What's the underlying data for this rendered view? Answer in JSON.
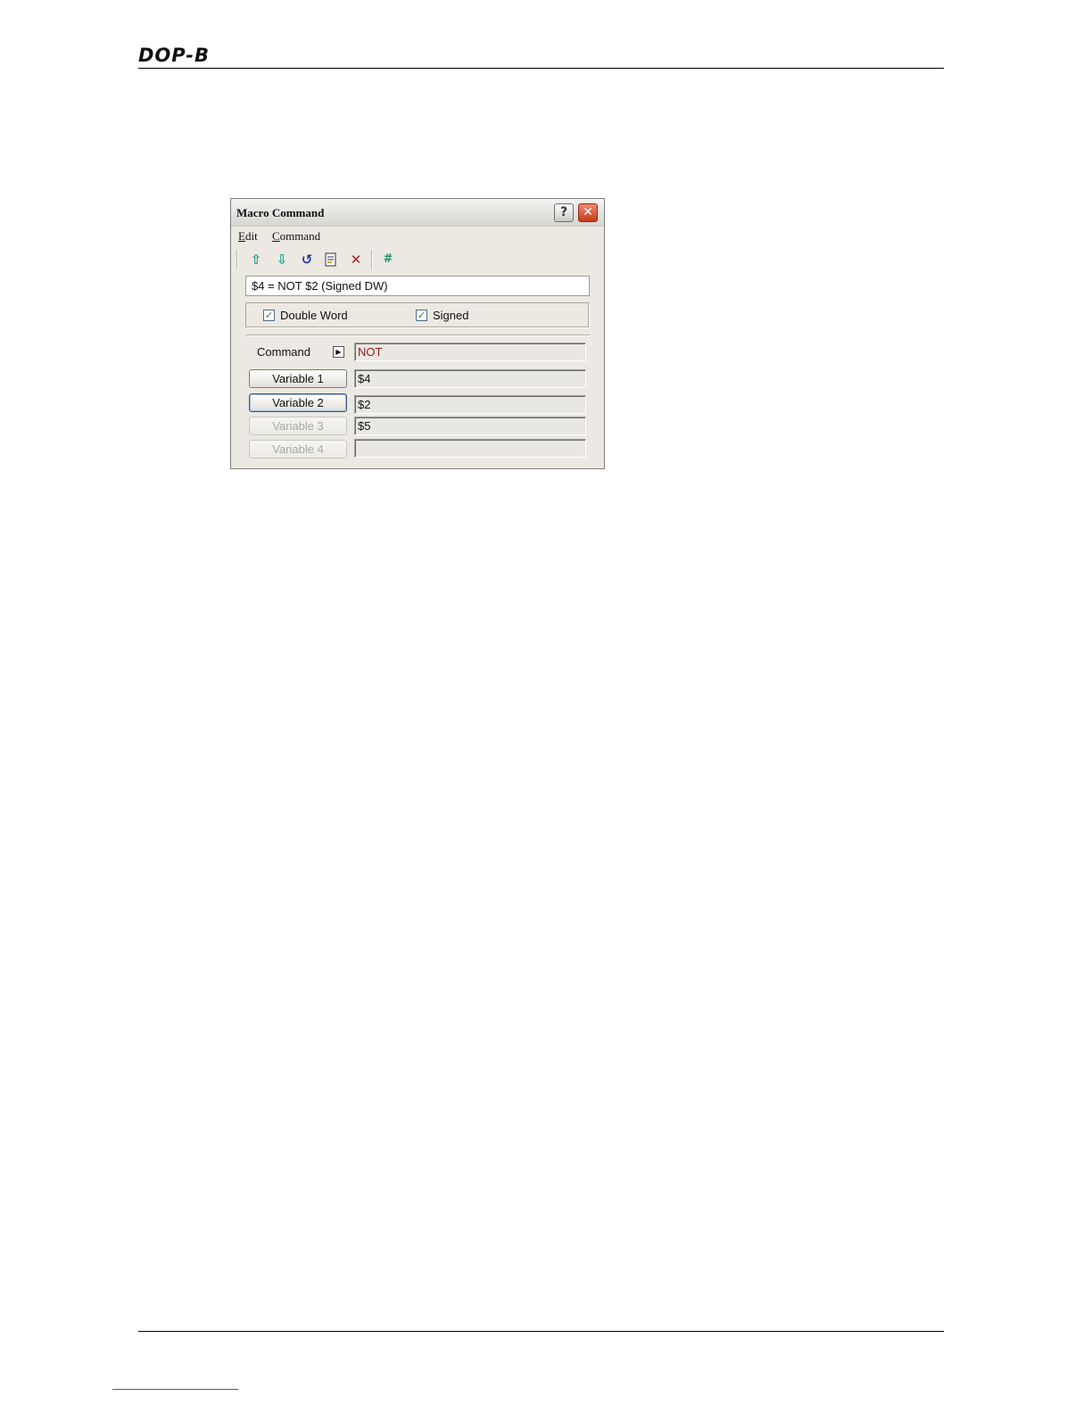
{
  "page": {
    "header_logo": "DOP-B"
  },
  "dialog": {
    "title": "Macro Command",
    "help_label": "?",
    "close_label": "✕",
    "menu": [
      "Edit",
      "Command"
    ],
    "toolbar_icons": [
      "arrow-up-icon",
      "arrow-down-icon",
      "refresh-icon",
      "document-icon",
      "delete-icon",
      "hash-icon"
    ],
    "expression": "$4 = NOT $2 (Signed DW)",
    "options": {
      "double_word": {
        "label": "Double Word",
        "checked": true
      },
      "signed": {
        "label": "Signed",
        "checked": true
      }
    },
    "command_label": "Command",
    "command_value": "NOT",
    "variables": [
      {
        "label": "Variable 1",
        "value": "$4",
        "enabled": true
      },
      {
        "label": "Variable 2",
        "value": "$2",
        "enabled": true
      },
      {
        "label": "Variable 3",
        "value": "$5",
        "enabled": false
      },
      {
        "label": "Variable 4",
        "value": "",
        "enabled": false
      }
    ],
    "colors": {
      "arrow_green": "#1aa38a",
      "refresh_blue": "#1f3f9a",
      "delete_red": "#b2221a",
      "command_text": "#8b1c1c"
    }
  }
}
